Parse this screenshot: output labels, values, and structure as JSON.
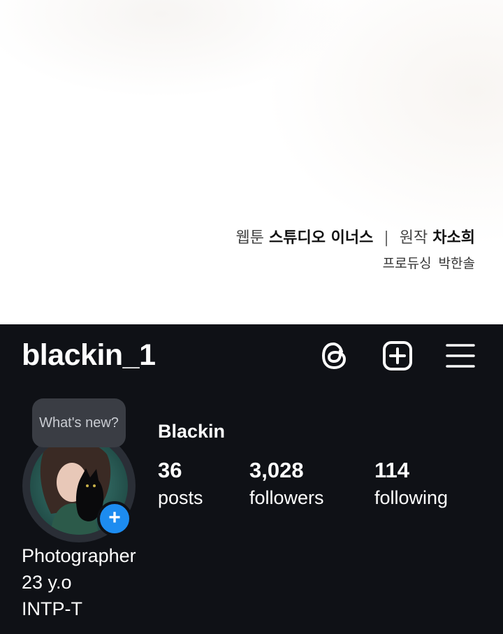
{
  "credits": {
    "webtoon_label": "웹툰",
    "webtoon_name": "스튜디오 이너스",
    "separator": "|",
    "original_label": "원작",
    "original_name": "차소희",
    "producing_label": "프로듀싱",
    "producing_name": "박한솔"
  },
  "profile": {
    "username": "blackin_1",
    "display_name": "Blackin",
    "note_bubble": "What's new?",
    "stats": [
      {
        "value": "36",
        "label": "posts"
      },
      {
        "value": "3,028",
        "label": "followers"
      },
      {
        "value": "114",
        "label": "following"
      }
    ],
    "bio": [
      "Photographer",
      "23 y.o",
      "INTP-T"
    ]
  },
  "header_icons": [
    "threads-icon",
    "add-post-icon",
    "menu-icon"
  ],
  "colors": {
    "panel_bg": "#0f1116",
    "badge_blue": "#1d8cf0",
    "bubble_bg": "#3a3d44"
  }
}
